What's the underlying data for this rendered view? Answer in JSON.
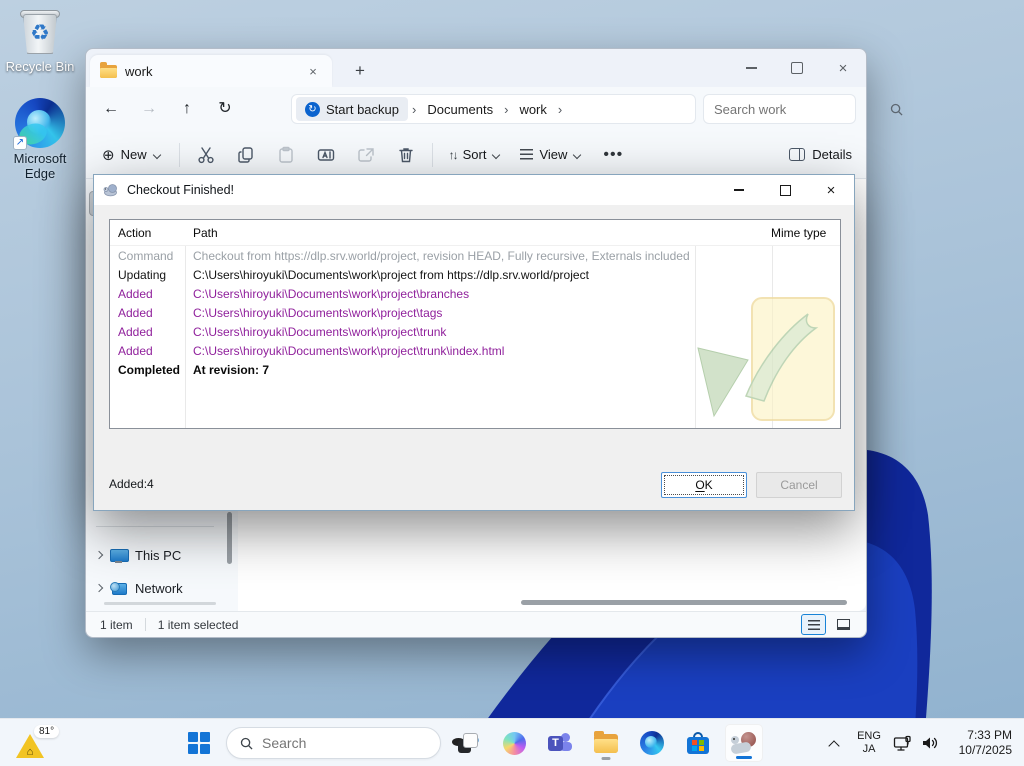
{
  "desktop": {
    "icons": [
      {
        "label": "Recycle Bin"
      },
      {
        "label": "Microsoft Edge"
      }
    ]
  },
  "icons": {
    "chevron_right": "›",
    "close": "×",
    "plus": "+",
    "back_arrow": "←",
    "forward_arrow": "→",
    "up_arrow": "↑",
    "refresh": "↻",
    "sync": "↻",
    "more_dots": "•••",
    "new_plus_circle": "⊕",
    "sort_arrows": "↑↓",
    "recycle": "♻"
  },
  "explorer": {
    "tab": {
      "title": "work"
    },
    "breadcrumb": {
      "items": [
        "Start backup",
        "Documents",
        "work"
      ]
    },
    "search_placeholder": "Search work",
    "toolbar": {
      "new_label": "New",
      "sort_label": "Sort",
      "view_label": "View",
      "details_label": "Details"
    },
    "sidebar": {
      "items": [
        "This PC",
        "Network"
      ]
    },
    "statusbar": {
      "count": "1 item",
      "selected": "1 item selected"
    }
  },
  "dialog": {
    "title": "Checkout Finished!",
    "table": {
      "columns": [
        "Action",
        "Path",
        "Mime type"
      ],
      "rows": [
        {
          "action": "Command",
          "path": "Checkout from https://dlp.srv.world/project, revision HEAD, Fully recursive, Externals included",
          "mime": "",
          "style": "muted"
        },
        {
          "action": "Updating",
          "path": "C:\\Users\\hiroyuki\\Documents\\work\\project from https://dlp.srv.world/project",
          "mime": "",
          "style": "normal"
        },
        {
          "action": "Added",
          "path": "C:\\Users\\hiroyuki\\Documents\\work\\project\\branches",
          "mime": "",
          "style": "added"
        },
        {
          "action": "Added",
          "path": "C:\\Users\\hiroyuki\\Documents\\work\\project\\tags",
          "mime": "",
          "style": "added"
        },
        {
          "action": "Added",
          "path": "C:\\Users\\hiroyuki\\Documents\\work\\project\\trunk",
          "mime": "",
          "style": "added"
        },
        {
          "action": "Added",
          "path": "C:\\Users\\hiroyuki\\Documents\\work\\project\\trunk\\index.html",
          "mime": "",
          "style": "added"
        },
        {
          "action": "Completed",
          "path": "At revision: 7",
          "mime": "",
          "style": "completed"
        }
      ]
    },
    "summary": "Added:4",
    "ok_first": "O",
    "ok_rest": "K",
    "cancel_label": "Cancel"
  },
  "taskbar": {
    "weather": "81°",
    "search_placeholder": "Search",
    "tray": {
      "lang_line1": "ENG",
      "lang_line2": "JA",
      "time": "7:33 PM",
      "date": "10/7/2025"
    }
  },
  "colors": {
    "accent": "#1374d6",
    "added_text": "#90219c",
    "muted_text": "#9aa0a6",
    "bloom_dark": "#10289b",
    "bloom_mid": "#1a3fc0"
  }
}
